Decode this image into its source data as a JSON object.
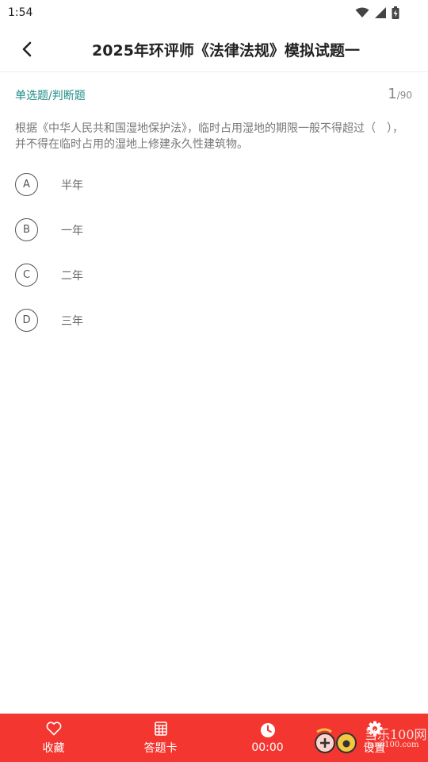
{
  "status_bar": {
    "time": "1:54"
  },
  "header": {
    "title": "2025年环评师《法律法规》模拟试题一"
  },
  "question": {
    "type_label": "单选题/判断题",
    "current": "1",
    "total": "/90",
    "text": "根据《中华人民共和国湿地保护法》，临时占用湿地的期限一般不得超过（　），并不得在临时占用的湿地上修建永久性建筑物。"
  },
  "options": [
    {
      "letter": "A",
      "text": "半年"
    },
    {
      "letter": "B",
      "text": "一年"
    },
    {
      "letter": "C",
      "text": "二年"
    },
    {
      "letter": "D",
      "text": "三年"
    }
  ],
  "bottom_bar": {
    "favorite_label": "收藏",
    "answer_card_label": "答题卡",
    "timer": "00:00",
    "settings_label": "设置"
  },
  "watermark": {
    "line1": "当乐100网",
    "line2": "danji100.com"
  },
  "colors": {
    "accent": "#1e8c86",
    "bottom_bar": "#f43630"
  }
}
